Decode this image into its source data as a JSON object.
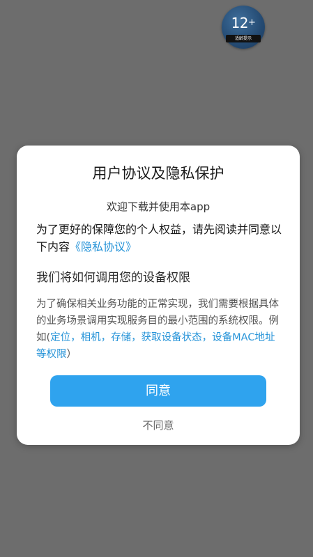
{
  "badge": {
    "rating": "12",
    "plus": "+",
    "caption": "适龄提示"
  },
  "dialog": {
    "title": "用户协议及隐私保护",
    "welcome": "欢迎下载并使用本app",
    "intro_text": "为了更好的保障您的个人权益，请先阅读并同意以下内容",
    "privacy_link": "《隐私协议》",
    "permissions_heading": "我们将如何调用您的设备权限",
    "permissions_text": "为了确保相关业务功能的正常实现，我们需要根据具体的业务场景调用实现服务目的最小范围的系统权限。例如(",
    "permissions_list": "定位，相机，存储，获取设备状态，设备MAC地址等权限",
    "permissions_close": "）",
    "agree_label": "同意",
    "disagree_label": "不同意"
  },
  "colors": {
    "overlay": "#6d6d6d",
    "accent": "#2fa3ee",
    "link": "#2593d8"
  }
}
